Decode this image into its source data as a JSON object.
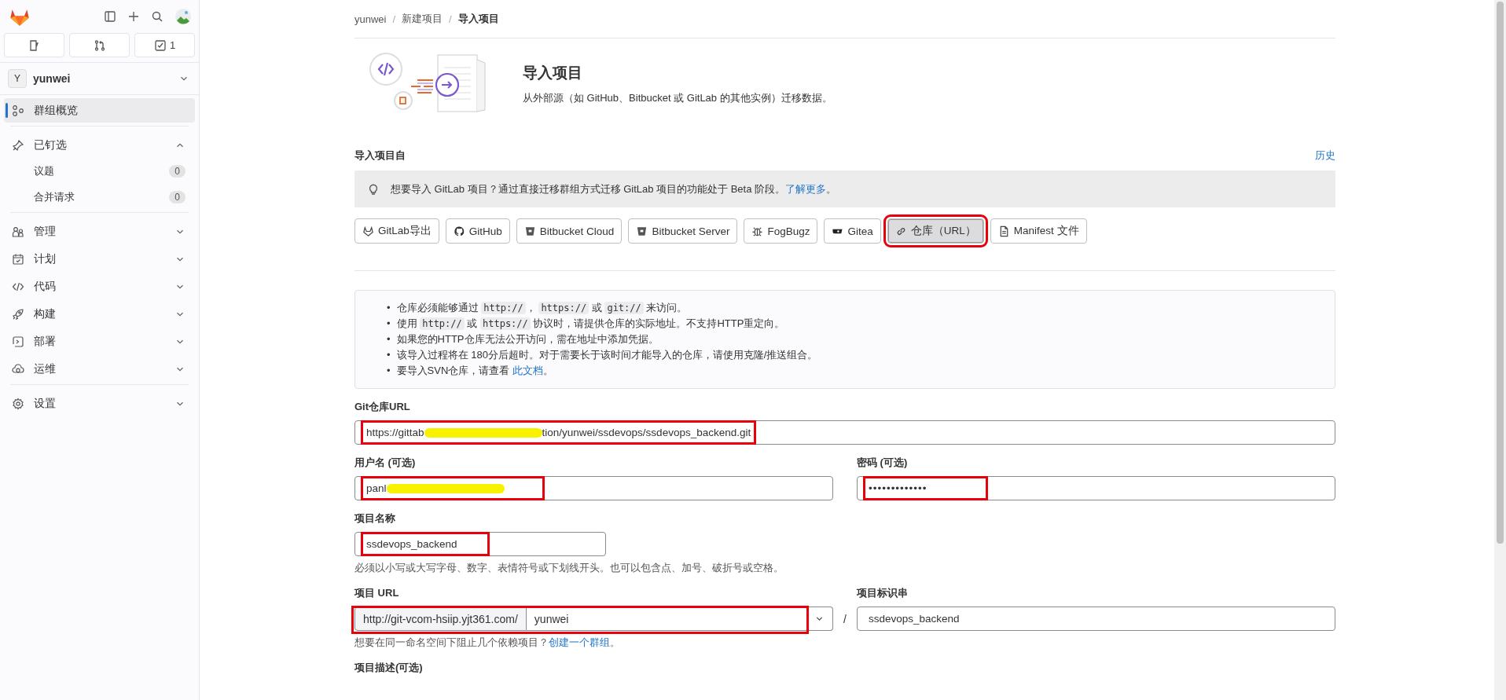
{
  "sidebar": {
    "todo_count": "1",
    "group": {
      "avatar": "Y",
      "name": "yunwei"
    },
    "sections": [
      {
        "items": [
          {
            "label": "群组概览",
            "kind": "overview",
            "selected": true
          }
        ]
      },
      {
        "items": [
          {
            "label": "已钉选",
            "kind": "pin",
            "selected": false,
            "expanded": true,
            "children": [
              {
                "label": "议题",
                "count": "0",
                "selected": false
              },
              {
                "label": "合并请求",
                "count": "0",
                "selected": false
              }
            ]
          }
        ]
      },
      {
        "items": [
          {
            "label": "管理",
            "kind": "users",
            "selected": false,
            "expanded": false
          },
          {
            "label": "计划",
            "kind": "calendar",
            "selected": false,
            "expanded": false
          },
          {
            "label": "代码",
            "kind": "code",
            "selected": false,
            "expanded": false
          },
          {
            "label": "构建",
            "kind": "rocket",
            "selected": false,
            "expanded": false
          },
          {
            "label": "部署",
            "kind": "deploy",
            "selected": false,
            "expanded": false
          },
          {
            "label": "运维",
            "kind": "cloud",
            "selected": false,
            "expanded": false
          }
        ]
      },
      {
        "items": [
          {
            "label": "设置",
            "kind": "gear",
            "selected": false,
            "expanded": false
          }
        ]
      }
    ]
  },
  "breadcrumb": {
    "separator": "/",
    "items": [
      "yunwei",
      "新建项目",
      "导入项目"
    ]
  },
  "header": {
    "title": "导入项目",
    "subtitle": "从外部源（如 GitHub、Bitbucket 或 GitLab 的其他实例）迁移数据。"
  },
  "import_from": {
    "label": "导入项目自",
    "history_link": "历史",
    "alert": {
      "text": "想要导入 GitLab 项目？通过直接迁移群组方式迁移 GitLab 项目的功能处于 Beta 阶段。",
      "link": "了解更多",
      "tail": "。"
    },
    "sources": [
      {
        "label": "GitLab导出",
        "kind": "tanuki",
        "selected": false,
        "annotated": false
      },
      {
        "label": "GitHub",
        "kind": "github",
        "selected": false,
        "annotated": false
      },
      {
        "label": "Bitbucket Cloud",
        "kind": "bucket",
        "selected": false,
        "annotated": false
      },
      {
        "label": "Bitbucket Server",
        "kind": "bucket",
        "selected": false,
        "annotated": false
      },
      {
        "label": "FogBugz",
        "kind": "bug",
        "selected": false,
        "annotated": false
      },
      {
        "label": "Gitea",
        "kind": "gitea",
        "selected": false,
        "annotated": false
      },
      {
        "label": "仓库（URL）",
        "kind": "link",
        "selected": true,
        "annotated": true
      },
      {
        "label": "Manifest 文件",
        "kind": "file",
        "selected": false,
        "annotated": false
      }
    ]
  },
  "info": {
    "bullet": "•",
    "items": [
      [
        {
          "kind": "text",
          "text": "仓库必须能够通过 "
        },
        {
          "kind": "code",
          "text": "http://"
        },
        {
          "kind": "text",
          "text": "， "
        },
        {
          "kind": "code",
          "text": "https://"
        },
        {
          "kind": "text",
          "text": " 或 "
        },
        {
          "kind": "code",
          "text": "git://"
        },
        {
          "kind": "text",
          "text": " 来访问。"
        }
      ],
      [
        {
          "kind": "text",
          "text": "使用 "
        },
        {
          "kind": "code",
          "text": "http://"
        },
        {
          "kind": "text",
          "text": " 或 "
        },
        {
          "kind": "code",
          "text": "https://"
        },
        {
          "kind": "text",
          "text": " 协议时，请提供仓库的实际地址。不支持HTTP重定向。"
        }
      ],
      [
        {
          "kind": "text",
          "text": "如果您的HTTP仓库无法公开访问，需在地址中添加凭据。"
        }
      ],
      [
        {
          "kind": "text",
          "text": "该导入过程将在 180分后超时。对于需要长于该时间才能导入的仓库，请使用克隆/推送组合。"
        }
      ],
      [
        {
          "kind": "text",
          "text": "要导入SVN仓库，请查看 "
        },
        {
          "kind": "link",
          "text": "此文档"
        },
        {
          "kind": "text",
          "text": "。"
        }
      ]
    ]
  },
  "form": {
    "repo_url": {
      "label": "Git仓库URL",
      "annotated": true,
      "value": [
        {
          "kind": "text",
          "text": "https://gittab"
        },
        {
          "kind": "redacted"
        },
        {
          "kind": "text",
          "text": "tion/yunwei/ssdevops/ssdevops_backend.git"
        }
      ]
    },
    "username": {
      "label": "用户名 (可选)",
      "annotated": true,
      "value": [
        {
          "kind": "text",
          "text": "panl"
        },
        {
          "kind": "redacted"
        }
      ]
    },
    "password": {
      "label": "密码 (可选)",
      "annotated": true,
      "value": "•••••••••••••"
    },
    "project_name": {
      "label": "项目名称",
      "annotated": true,
      "value": "ssdevops_backend",
      "help": "必须以小写或大写字母、数字、表情符号或下划线开头。也可以包含点、加号、破折号或空格。"
    },
    "project_url": {
      "label": "项目 URL",
      "annotated": true,
      "prefix": "http://git-vcom-hsiip.yjt361.com/",
      "namespace": "yunwei",
      "separator": "/",
      "help": "想要在同一命名空间下阻止几个依赖项目？",
      "help_link": "创建一个群组",
      "help_tail": "。"
    },
    "slug": {
      "label": "项目标识串",
      "value": "ssdevops_backend"
    },
    "description": {
      "label": "项目描述(可选)"
    }
  }
}
